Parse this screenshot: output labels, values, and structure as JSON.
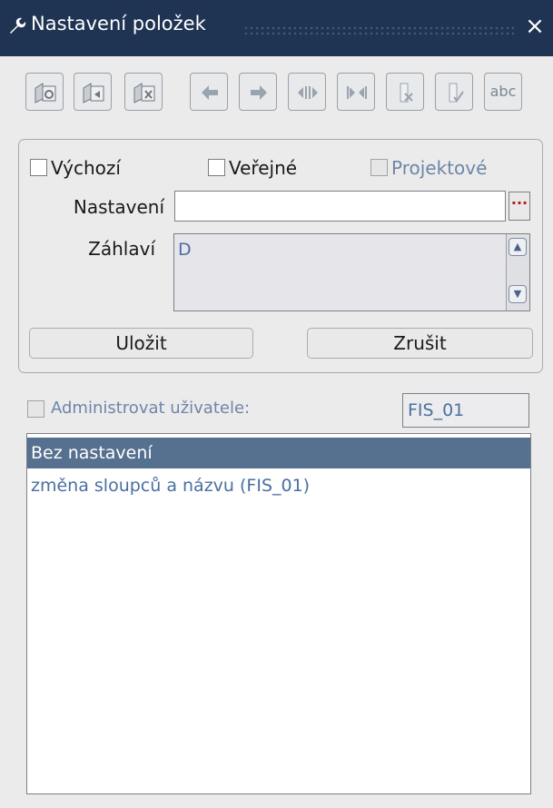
{
  "window": {
    "title": "Nastavení položek",
    "close_symbol": "×",
    "title_icon": "wrench-icon"
  },
  "toolbar": {
    "buttons": [
      {
        "name": "refresh-settings-button",
        "icon": "folder-refresh-icon",
        "enabled": true
      },
      {
        "name": "load-settings-button",
        "icon": "folder-load-icon",
        "enabled": true
      },
      {
        "name": "delete-settings-button",
        "icon": "folder-delete-icon",
        "enabled": true
      },
      {
        "name": "move-left-button",
        "icon": "arrow-left-icon",
        "enabled": false
      },
      {
        "name": "move-right-button",
        "icon": "arrow-right-icon",
        "enabled": false
      },
      {
        "name": "expand-column-button",
        "icon": "expand-horizontal-icon",
        "enabled": false
      },
      {
        "name": "shrink-column-button",
        "icon": "shrink-horizontal-icon",
        "enabled": false
      },
      {
        "name": "hide-column-button",
        "icon": "hide-column-icon",
        "enabled": false
      },
      {
        "name": "show-column-button",
        "icon": "show-column-icon",
        "enabled": false
      },
      {
        "name": "text-button",
        "label": "abc",
        "enabled": false
      }
    ]
  },
  "form": {
    "default_label": "Výchozí",
    "public_label": "Veřejné",
    "project_label": "Projektové",
    "setting_label": "Nastavení",
    "setting_value": "",
    "lov_symbol": "···",
    "header_label": "Záhlaví",
    "header_value": "D",
    "save_label": "Uložit",
    "cancel_label": "Zrušit"
  },
  "admin": {
    "label": "Administrovat uživatele:",
    "user_value": "FIS_01"
  },
  "list": {
    "items": [
      {
        "label": "Bez nastavení",
        "selected": true
      },
      {
        "label": "změna sloupců a názvu   (FIS_01)",
        "selected": false
      }
    ]
  },
  "colors": {
    "titlebar": "#1f3453",
    "selection": "#56708f",
    "disabled_text": "#6d86a8"
  }
}
